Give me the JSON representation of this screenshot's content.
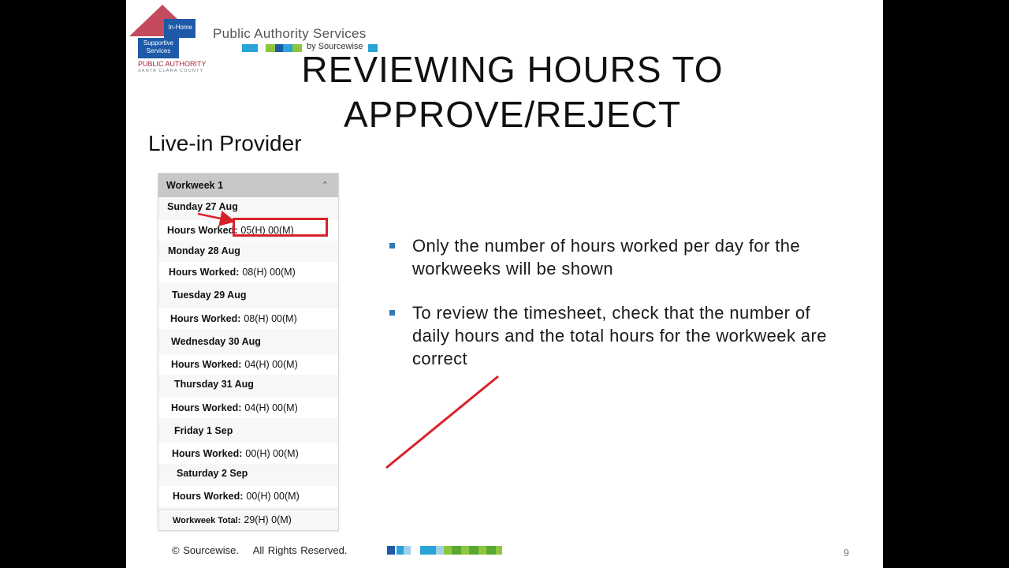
{
  "logo": {
    "in_home": "In-Home",
    "supportive": "Supportive",
    "services": "Services",
    "public_authority": "PUBLIC AUTHORITY",
    "county": "SANTA CLARA COUNTY"
  },
  "brand": {
    "title": "Public Authority Services",
    "subtitle": "by Sourcewise"
  },
  "slide": {
    "title_line1": "REVIEWING HOURS TO",
    "title_line2": "APPROVE/REJECT",
    "subtitle": "Live-in Provider"
  },
  "timesheet": {
    "header": "Workweek 1",
    "hours_label": "Hours Worked:",
    "days": [
      {
        "day": "Sunday 27 Aug",
        "hours": "05(H) 00(M)"
      },
      {
        "day": "Monday 28 Aug",
        "hours": "08(H) 00(M)"
      },
      {
        "day": "Tuesday 29 Aug",
        "hours": "08(H) 00(M)"
      },
      {
        "day": "Wednesday 30 Aug",
        "hours": "04(H) 00(M)"
      },
      {
        "day": "Thursday 31 Aug",
        "hours": "04(H) 00(M)"
      },
      {
        "day": "Friday 1 Sep",
        "hours": "00(H) 00(M)"
      },
      {
        "day": "Saturday 2 Sep",
        "hours": "00(H) 00(M)"
      }
    ],
    "total_label": "Workweek Total:",
    "total_value": "29(H) 0(M)"
  },
  "bullets": [
    "Only the number of hours worked per day for the workweeks will be shown",
    "To review the timesheet, check that the number of daily hours and the total hours for the workweek are correct"
  ],
  "footer": {
    "copyright": "© Sourcewise.    All Rights Reserved.",
    "page_number": "9"
  },
  "colors": {
    "bullet": "#2e7ab8",
    "annotation": "#d8222b",
    "logo_blue": "#1e5aa8",
    "logo_red": "#c44a5e"
  }
}
